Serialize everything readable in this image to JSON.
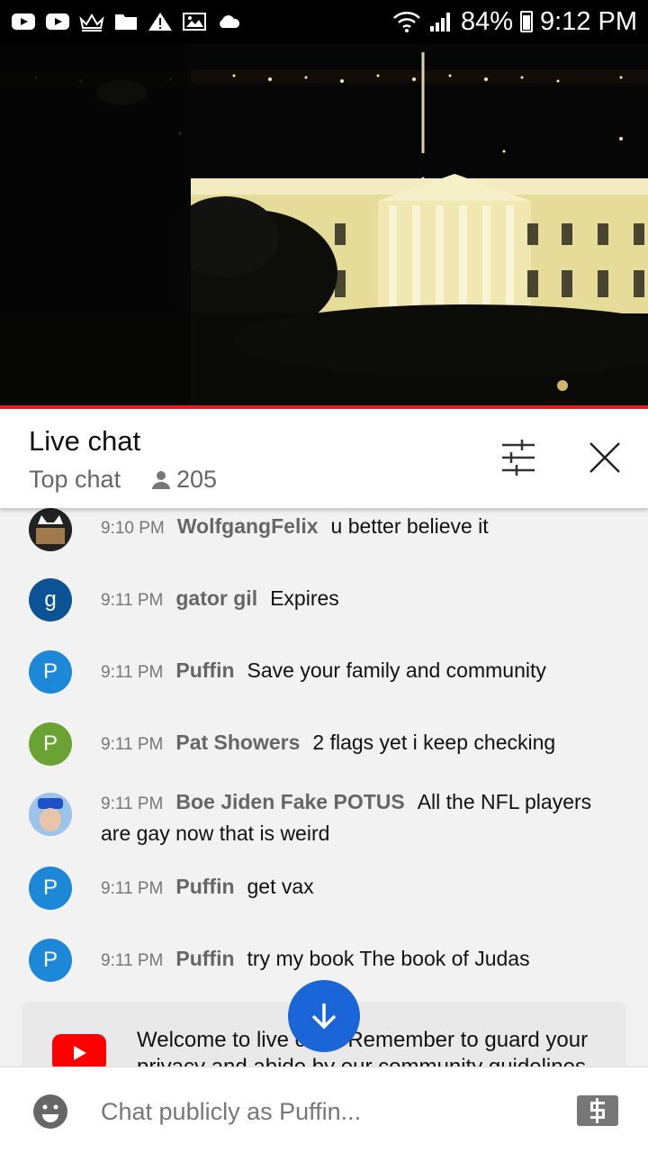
{
  "status_bar": {
    "icons": [
      "youtube-icon",
      "youtube-icon",
      "crown-icon",
      "folder-icon",
      "warning-icon",
      "image-icon",
      "cloud-icon"
    ],
    "wifi": "wifi-icon",
    "signal": "signal-icon",
    "battery": "84%",
    "time": "9:12 PM"
  },
  "video": {
    "scene": "white-house-night-livestream",
    "progress_color": "#e02020"
  },
  "chat_header": {
    "title": "Live chat",
    "mode": "Top chat",
    "viewers": "205"
  },
  "messages": [
    {
      "time": "9:10 PM",
      "author": "WolfgangFelix",
      "text": "u better believe it",
      "avatar": "",
      "avatar_color": "#444444"
    },
    {
      "time": "9:11 PM",
      "author": "gator gil",
      "text": "Expires",
      "avatar": "g",
      "avatar_color": "#0b5394"
    },
    {
      "time": "9:11 PM",
      "author": "Puffin",
      "text": "Save your family and community",
      "avatar": "P",
      "avatar_color": "#1e88d8"
    },
    {
      "time": "9:11 PM",
      "author": "Pat Showers",
      "text": "2 flags yet i keep checking",
      "avatar": "P",
      "avatar_color": "#6aa334"
    },
    {
      "time": "9:11 PM",
      "author": "Boe Jiden Fake POTUS",
      "text": "All the NFL players are gay now that is weird",
      "avatar": "",
      "avatar_color": "#8ab4e0"
    },
    {
      "time": "9:11 PM",
      "author": "Puffin",
      "text": "get vax",
      "avatar": "P",
      "avatar_color": "#1e88d8"
    },
    {
      "time": "9:11 PM",
      "author": "Puffin",
      "text": "try my book The book of Judas",
      "avatar": "P",
      "avatar_color": "#1e88d8"
    }
  ],
  "welcome": {
    "text": "Welcome to live chat! Remember to guard your privacy and abide by our community guidelines."
  },
  "input": {
    "placeholder": "Chat publicly as Puffin..."
  },
  "colors": {
    "accent": "#1a66d8",
    "youtube_red": "#ff0000"
  }
}
